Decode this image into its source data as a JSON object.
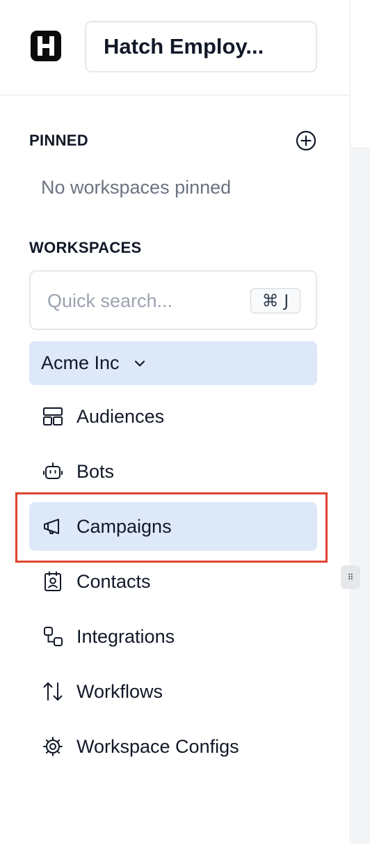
{
  "org": {
    "name": "Hatch Employ..."
  },
  "pinned": {
    "title": "PINNED",
    "empty_text": "No workspaces pinned",
    "add_icon": "plus-circle-icon"
  },
  "workspaces": {
    "title": "WORKSPACES",
    "search": {
      "placeholder": "Quick search...",
      "shortcut": "⌘ J"
    },
    "selected": "Acme Inc",
    "items": [
      {
        "label": "Audiences",
        "icon": "layout-icon"
      },
      {
        "label": "Bots",
        "icon": "bot-icon"
      },
      {
        "label": "Campaigns",
        "icon": "megaphone-icon",
        "active": true
      },
      {
        "label": "Contacts",
        "icon": "contact-card-icon"
      },
      {
        "label": "Integrations",
        "icon": "integration-icon"
      },
      {
        "label": "Workflows",
        "icon": "arrows-up-down-icon"
      },
      {
        "label": "Workspace Configs",
        "icon": "gear-icon"
      }
    ]
  },
  "colors": {
    "active_bg": "#dde8f9",
    "highlight": "#e0432e",
    "muted_text": "#6b7280"
  }
}
